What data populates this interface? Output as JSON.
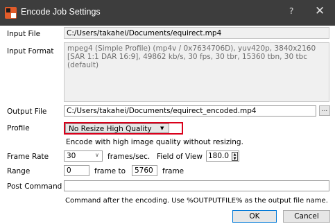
{
  "window": {
    "title": "Encode Job Settings",
    "help_glyph": "?",
    "close_glyph": "✕"
  },
  "input_file": {
    "label": "Input File",
    "value": "C:/Users/takahei/Documents/equirect.mp4"
  },
  "input_format": {
    "label": "Input Format",
    "value": "mpeg4 (Simple Profile) (mp4v / 0x7634706D), yuv420p, 3840x2160 [SAR 1:1 DAR 16:9], 49862 kb/s, 30 fps, 30 tbr, 15360 tbn, 30 tbc (default)"
  },
  "output_file": {
    "label": "Output File",
    "value": "C:/Users/takahei/Documents/equirect_encoded.mp4",
    "browse_label": "..."
  },
  "profile": {
    "label": "Profile",
    "selected": "No Resize High Quality",
    "description": "Encode with high image quality without resizing."
  },
  "frame_rate": {
    "label": "Frame Rate",
    "value": "30",
    "unit": "frames/sec.",
    "fov_label": "Field of View",
    "fov_value": "180.0"
  },
  "range": {
    "label": "Range",
    "start": "0",
    "middle_text": "frame  to",
    "end": "5760",
    "unit": "frame"
  },
  "post_command": {
    "label": "Post Command",
    "value": "",
    "help": "Command after the encoding. Use %OUTPUTFILE% as the output file name."
  },
  "buttons": {
    "ok": "OK",
    "cancel": "Cancel"
  },
  "icons": {
    "app": "app-icon",
    "dropdown": "chevron-down-icon",
    "spin": "spin-arrows-icon"
  },
  "colors": {
    "titlebar": "#3d3d3d",
    "highlight": "#d9001b",
    "default_button": "#0078d7"
  }
}
